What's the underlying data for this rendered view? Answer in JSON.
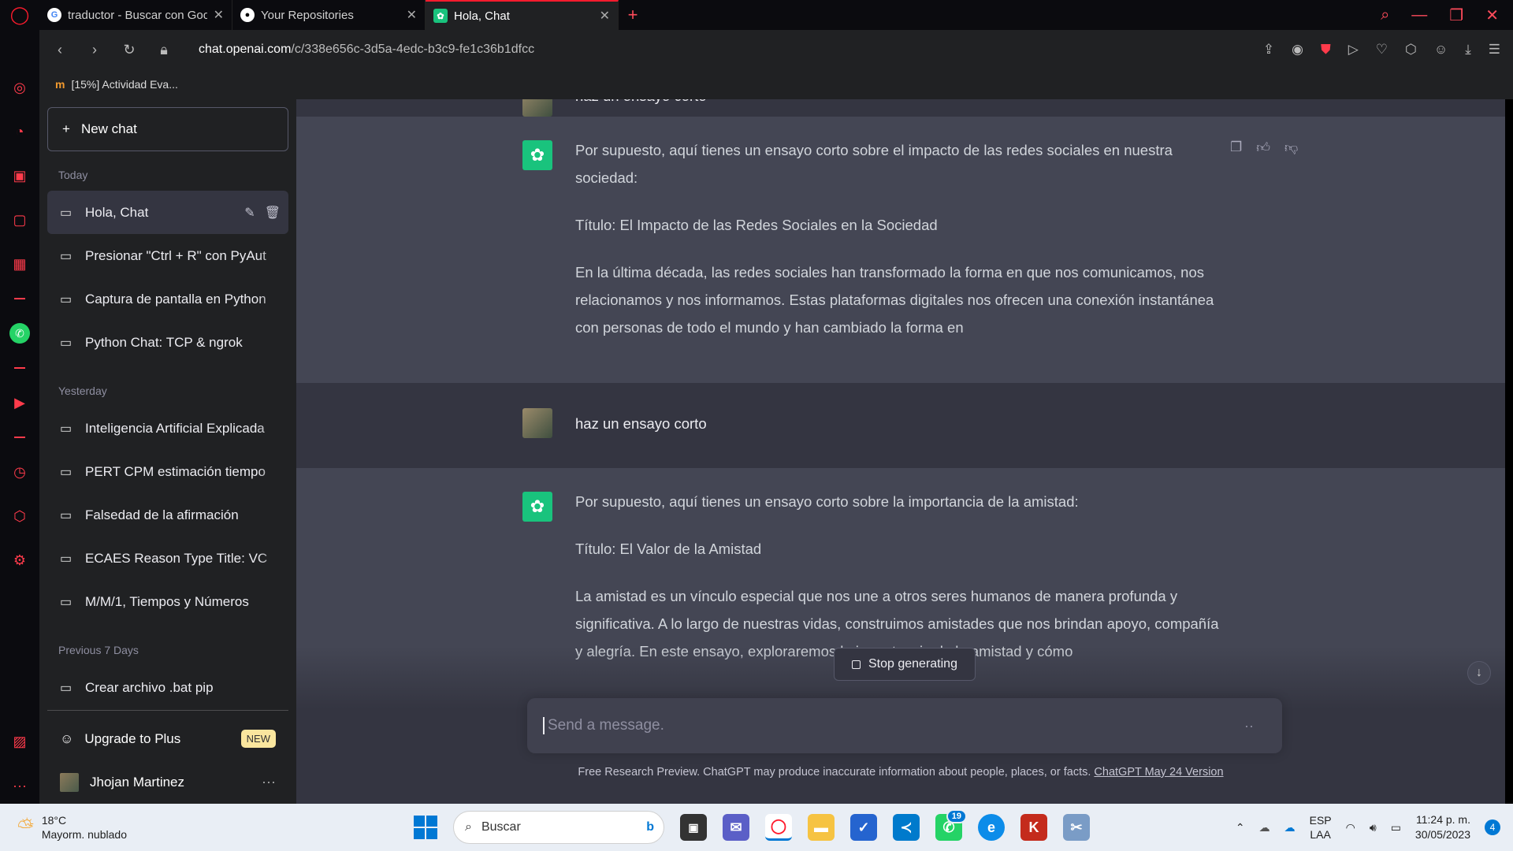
{
  "browser": {
    "tabs": [
      {
        "title": "traductor - Buscar con Goo",
        "favicon": "google-icon"
      },
      {
        "title": "Your Repositories",
        "favicon": "github-icon"
      },
      {
        "title": "Hola, Chat",
        "favicon": "chatgpt-icon",
        "active": true
      }
    ],
    "url_host": "chat.openai.com",
    "url_path": "/c/338e656c-3d5a-4edc-b3c9-fe1c36b1dfcc",
    "bookmark": "[15%] Actividad Eva..."
  },
  "sidebar": {
    "new_chat": "New chat",
    "sections": [
      {
        "label": "Today",
        "items": [
          "Hola, Chat",
          "Presionar \"Ctrl + R\" con PyAut",
          "Captura de pantalla en Python",
          "Python Chat: TCP & ngrok"
        ]
      },
      {
        "label": "Yesterday",
        "items": [
          "Inteligencia Artificial Explicada",
          "PERT CPM estimación tiempo",
          "Falsedad de la afirmación",
          "ECAES Reason Type Title: VC",
          "M/M/1, Tiempos y Números"
        ]
      },
      {
        "label": "Previous 7 Days",
        "items": [
          "Crear archivo .bat pip"
        ]
      }
    ],
    "upgrade": "Upgrade to Plus",
    "upgrade_badge": "NEW",
    "user_name": "Jhojan Martinez"
  },
  "conversation": {
    "top_partial": "haz un ensayo corto",
    "ai_1": {
      "p1": "Por supuesto, aquí tienes un ensayo corto sobre el impacto de las redes sociales en nuestra sociedad:",
      "p2": "Título: El Impacto de las Redes Sociales en la Sociedad",
      "p3": "En la última década, las redes sociales han transformado la forma en que nos comunicamos, nos relacionamos y nos informamos. Estas plataformas digitales nos ofrecen una conexión instantánea con personas de todo el mundo y han cambiado la forma en"
    },
    "user_1": "haz un ensayo corto",
    "ai_2": {
      "p1": "Por supuesto, aquí tienes un ensayo corto sobre la importancia de la amistad:",
      "p2": "Título: El Valor de la Amistad",
      "p3": "La amistad es un vínculo especial que nos une a otros seres humanos de manera profunda y significativa. A lo largo de nuestras vidas, construimos amistades que nos brindan apoyo, compañía y alegría. En este ensayo, exploraremos la importancia de la amistad y cómo"
    }
  },
  "composer": {
    "stop_label": "Stop generating",
    "placeholder": "Send a message.",
    "footer_text": "Free Research Preview. ChatGPT may produce inaccurate information about people, places, or facts.",
    "footer_link": "ChatGPT May 24 Version"
  },
  "taskbar": {
    "temp": "18°C",
    "weather": "Mayorm. nublado",
    "search_placeholder": "Buscar",
    "whatsapp_badge": "19",
    "lang_1": "ESP",
    "lang_2": "LAA",
    "time": "11:24 p. m.",
    "date": "30/05/2023",
    "notifications": "4"
  },
  "colors": {
    "accent_chatgpt": "#19c37d",
    "opera_red": "#ff1b2d",
    "sidebar_bg": "#202123",
    "main_bg": "#343541",
    "ai_msg_bg": "#444654"
  }
}
